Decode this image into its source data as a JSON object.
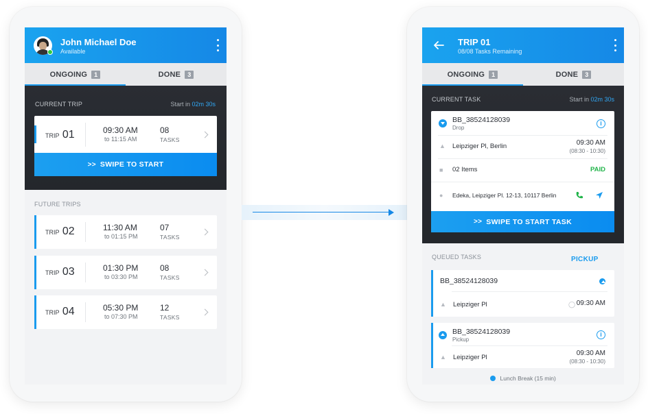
{
  "left": {
    "header": {
      "name": "John Michael Doe",
      "status": "Available"
    },
    "tabs": [
      {
        "label": "ONGOING",
        "count": "1"
      },
      {
        "label": "DONE",
        "count": "3"
      }
    ],
    "current": {
      "section_label": "CURRENT TRIP",
      "start_in_prefix": "Start in",
      "start_in_value": "02m 30s",
      "trip": {
        "prefix": "TRIP",
        "num": "01",
        "start": "09:30 AM",
        "end": "to 11:15 AM",
        "tasks": "08",
        "tasks_label": "TASKS"
      },
      "swipe_label": "SWIPE TO START"
    },
    "future": {
      "section_label": "FUTURE TRIPS",
      "trips": [
        {
          "prefix": "TRIP",
          "num": "02",
          "start": "11:30 AM",
          "end": "to 01:15 PM",
          "tasks": "07",
          "tasks_label": "TASKS"
        },
        {
          "prefix": "TRIP",
          "num": "03",
          "start": "01:30 PM",
          "end": "to 03:30 PM",
          "tasks": "08",
          "tasks_label": "TASKS"
        },
        {
          "prefix": "TRIP",
          "num": "04",
          "start": "05:30 PM",
          "end": "to 07:30 PM",
          "tasks": "12",
          "tasks_label": "TASKS"
        }
      ]
    }
  },
  "right": {
    "header": {
      "title": "TRIP 01",
      "subtitle": "08/08 Tasks Remaining"
    },
    "tabs": [
      {
        "label": "ONGOING",
        "count": "1"
      },
      {
        "label": "DONE",
        "count": "3"
      }
    ],
    "current": {
      "section_label": "CURRENT TASK",
      "start_in_prefix": "Start in",
      "start_in_value": "02m 30s",
      "task": {
        "id": "BB_38524128039",
        "type": "Drop",
        "location": "Leipziger Pl, Berlin",
        "time": "09:30 AM",
        "window": "(08:30 - 10:30)",
        "items": "02 Items",
        "payment": "PAID",
        "address": "Edeka, Leipziger Pl. 12-13, 10117 Berlin"
      },
      "swipe_label": "SWIPE TO START TASK"
    },
    "queued": {
      "section_label": "QUEUED TASKS",
      "pickup_label": "PICKUP",
      "tasks": [
        {
          "id": "BB_38524128039",
          "location": "Leipziger Pl",
          "time": "09:30 AM"
        },
        {
          "id": "BB_38524128039",
          "type": "Pickup",
          "location": "Leipziger Pl",
          "time": "09:30 AM",
          "window": "(08:30 - 10:30)"
        }
      ],
      "break_label": "Lunch Break (15 min)"
    }
  },
  "colors": {
    "accent": "#1a9bee",
    "dark_panel": "#272a2f",
    "paid": "#21b44a"
  }
}
